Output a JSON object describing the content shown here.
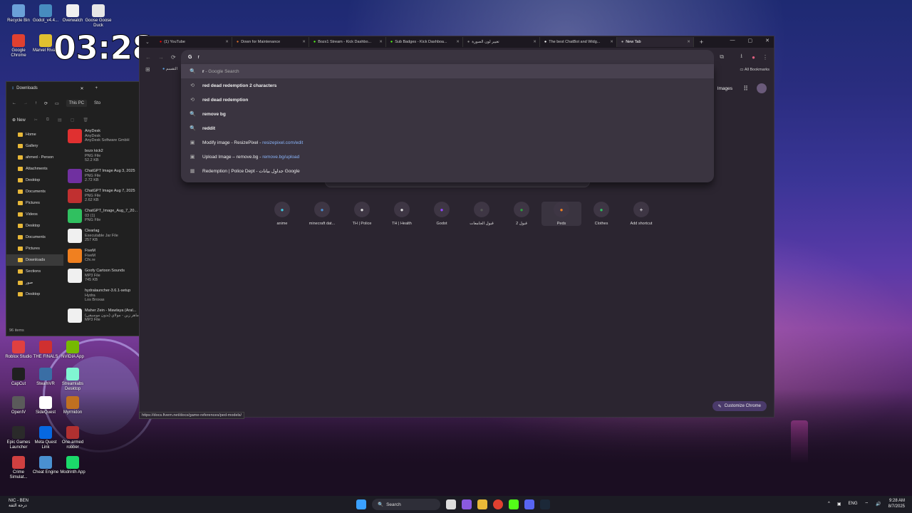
{
  "clock": "03:28",
  "desktop_icons": [
    {
      "label": "Recycle Bin",
      "x": 0,
      "y": 0,
      "color": "#6aa0d8"
    },
    {
      "label": "Godot_v4.4...",
      "color": "#478cbf"
    },
    {
      "label": "Overwatch",
      "color": "#f0f0f0"
    },
    {
      "label": "Goose Goose Duck",
      "color": "#e6e6e6"
    },
    {
      "label": "Google Chrome",
      "color": "#e04030"
    },
    {
      "label": "Marvel Rivals",
      "color": "#e0c030"
    },
    {
      "label": "Roblox Studio",
      "color": "#e04040"
    },
    {
      "label": "THE FINALS",
      "color": "#d03030"
    },
    {
      "label": "NVIDIA App",
      "color": "#76b900"
    },
    {
      "label": "CapCut",
      "color": "#202020"
    },
    {
      "label": "SteamVR",
      "color": "#3a6ea5"
    },
    {
      "label": "Streamlabs Desktop",
      "color": "#80f5d2"
    },
    {
      "label": "OpenIV",
      "color": "#5a5a5a"
    },
    {
      "label": "SideQuest",
      "color": "#ffffff"
    },
    {
      "label": "Myrmidon",
      "color": "#c07020"
    },
    {
      "label": "Epic Games Launcher",
      "color": "#2a2a2a"
    },
    {
      "label": "Meta Quest Link",
      "color": "#0668e1"
    },
    {
      "label": "One-armed robber",
      "color": "#b03030"
    },
    {
      "label": "Crime Simulat...",
      "color": "#d04040"
    },
    {
      "label": "Cheat Engine",
      "color": "#4a90d0"
    },
    {
      "label": "Modrinth App",
      "color": "#1bd96a"
    }
  ],
  "explorer": {
    "tab": "Downloads",
    "breadcrumb": [
      "This PC",
      "Sto"
    ],
    "new_label": "New",
    "sidebar": [
      "Home",
      "Gallery",
      "ahmed - Person",
      "Attachments",
      "Desktop",
      "Documents",
      "Pictures",
      "Videos",
      "Desktop",
      "Documents",
      "Pictures",
      "Downloads",
      "Sections",
      "صور",
      "Desktop"
    ],
    "files": [
      {
        "name": "AnyDesk",
        "sub": "AnyDesk",
        "sub2": "AnyDesk Software GmbH",
        "color": "#e03030"
      },
      {
        "name": "bozx kick2",
        "sub": "PNG File",
        "sub2": "52.2 KB",
        "color": "#202020"
      },
      {
        "name": "ChatGPT Image Aug 3, 2025",
        "sub": "PNG File",
        "sub2": "2.72 KB",
        "color": "#7030a0"
      },
      {
        "name": "ChatGPT Image Aug 7, 2025",
        "sub": "PNG File",
        "sub2": "2.62 KB",
        "color": "#c03030"
      },
      {
        "name": "ChatGPT_Image_Aug_7_20...",
        "sub": "03 (1)",
        "sub2": "PNG File",
        "color": "#30c060"
      },
      {
        "name": "Clearlag",
        "sub": "Executable Jar File",
        "sub2": "257 KB",
        "color": "#f0f0f0"
      },
      {
        "name": "FiveM",
        "sub": "FiveM",
        "sub2": "Cfx.re",
        "color": "#f08020"
      },
      {
        "name": "Goofy Cartoon Sounds",
        "sub": "MP3 File",
        "sub2": "745 KB",
        "color": "#f0f0f0"
      },
      {
        "name": "hydralauncher-3.6.1-setup",
        "sub": "Hydra",
        "sub2": "Los Broxas",
        "color": "#202020"
      },
      {
        "name": "Maher Zein - Mawlaya (Aral...",
        "sub": "ماهر زين - مولاي (بدون موسيقى)",
        "sub2": "MP3 File",
        "color": "#f0f0f0"
      }
    ],
    "status": "96 items"
  },
  "chrome": {
    "tabs": [
      {
        "title": "(1) YouTube",
        "color": "#ff0000"
      },
      {
        "title": "Down for Maintenance",
        "color": "#e0702a"
      },
      {
        "title": "Bozx1 Stream - Kick Dashbo...",
        "color": "#53fc18"
      },
      {
        "title": "Sub Badges - Kick Dashboa...",
        "color": "#53fc18"
      },
      {
        "title": "تغيير لون الصورة",
        "color": "#888888"
      },
      {
        "title": "The best ChatBot and Widg...",
        "color": "#ffffff"
      },
      {
        "title": "New Tab",
        "color": "#aaaaaa"
      }
    ],
    "omnibox_text": "r",
    "suggestions": [
      {
        "icon": "🔍",
        "bold": "r",
        "rest": " - Google Search",
        "link": ""
      },
      {
        "icon": "⟲",
        "bold": "red dead redemption 2 characters",
        "rest": "",
        "link": ""
      },
      {
        "icon": "⟲",
        "bold": "red dead redemption",
        "rest": "",
        "link": ""
      },
      {
        "icon": "🔍",
        "bold": "remove bg",
        "rest": "",
        "link": ""
      },
      {
        "icon": "🔍",
        "bold": "reddit",
        "rest": "",
        "link": ""
      },
      {
        "icon": "▣",
        "bold": "",
        "rest": "Modify image - ResizePixel - ",
        "link": "resizepixel.com/edit"
      },
      {
        "icon": "▣",
        "bold": "",
        "rest": "Upload Image – remove.bg - ",
        "link": "remove.bg/upload"
      },
      {
        "icon": "▦",
        "bold": "",
        "rest": "Redemption | Police Dept - جداول بيانات Google",
        "link": ""
      }
    ],
    "bookmark_label": "التقسم",
    "all_bookmarks": "All Bookmarks",
    "images_label": "Images",
    "shortcuts": [
      {
        "label": "anime",
        "color": "#3ec6e0"
      },
      {
        "label": "minecraft dat...",
        "color": "#4a90d0"
      },
      {
        "label": "TH | Police",
        "color": "#dddddd"
      },
      {
        "label": "TH | Health",
        "color": "#dddddd"
      },
      {
        "label": "Godot",
        "color": "#9146ff"
      },
      {
        "label": "قبول الجامعات",
        "color": "#555555"
      },
      {
        "label": "قبول 2",
        "color": "#30a040"
      },
      {
        "label": "Peds",
        "color": "#f08020"
      },
      {
        "label": "Clothes",
        "color": "#30c060"
      },
      {
        "label": "Add shortcut",
        "color": "#ffffff"
      }
    ],
    "customize_label": "Customize Chrome",
    "status_url": "https://docs.fivem.net/docs/game-references/ped-models/"
  },
  "taskbar": {
    "weather_title": "NIC - BEN",
    "weather_sub": "درجة الثقة",
    "search_label": "Search",
    "lang": "ENG",
    "time": "9:28 AM",
    "date": "8/7/2025"
  }
}
